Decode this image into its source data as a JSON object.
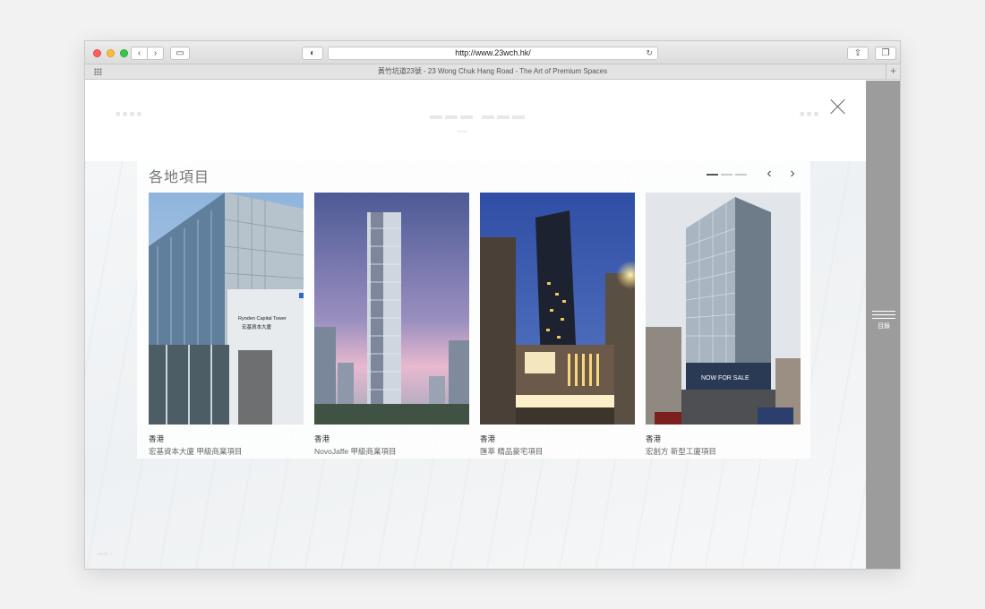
{
  "browser": {
    "url": "http://www.23wch.hk/",
    "tab_title": "黃竹坑道23號 - 23 Wong Chuk Hang Road - The Art of Premium Spaces",
    "back_glyph": "‹",
    "forward_glyph": "›",
    "reload_glyph": "↻",
    "share_glyph": "⇪",
    "tabs_glyph": "❐",
    "shield_glyph": "◐",
    "sidebar_glyph": "▭",
    "plus_glyph": "+"
  },
  "section": {
    "title": "各地項目",
    "prev_glyph": "‹",
    "next_glyph": "›",
    "pager_pages": 3,
    "pager_active": 1
  },
  "projects": [
    {
      "city": "香港",
      "name": "宏基資本大廈 甲級商業項目"
    },
    {
      "city": "香港",
      "name": "NovoJaffe 甲級商業項目"
    },
    {
      "city": "香港",
      "name": "匯萃 精品豪宅項目"
    },
    {
      "city": "香港",
      "name": "宏創方 新型工廈項目"
    }
  ],
  "building_signage": {
    "tower_en": "Ryoden Capital Tower",
    "tower_zh": "宏基資本大廈",
    "banner": "NOW FOR SALE"
  },
  "menu": {
    "label": "目錄"
  },
  "colors": {
    "rail": "#9c9c9c",
    "pager_active": "#555555",
    "pager_inactive": "#c9c9c9"
  }
}
